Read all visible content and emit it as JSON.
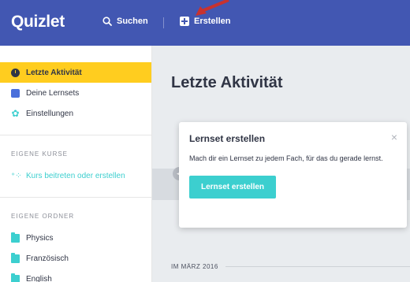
{
  "header": {
    "logo": "Quizlet",
    "search_label": "Suchen",
    "create_label": "Erstellen",
    "bg_color": "#4257b2"
  },
  "sidebar": {
    "items": [
      {
        "label": "Letzte Aktivität",
        "icon": "clock-icon",
        "active": true
      },
      {
        "label": "Deine Lernsets",
        "icon": "cards-icon"
      },
      {
        "label": "Einstellungen",
        "icon": "gear-icon"
      }
    ],
    "courses_heading": "EIGENE KURSE",
    "course_link": "Kurs beitreten oder erstellen",
    "folders_heading": "EIGENE ORDNER",
    "folders": [
      "Physics",
      "Französisch",
      "English"
    ],
    "active_color": "#ffcd1f",
    "accent_color": "#3ccfcf"
  },
  "main": {
    "title": "Letzte Aktivität",
    "month": "IM MÄRZ 2016"
  },
  "popup": {
    "title": "Lernset erstellen",
    "description": "Mach dir ein Lernset zu jedem Fach, für das du gerade lernst.",
    "button_label": "Lernset erstellen",
    "close_symbol": "×"
  }
}
